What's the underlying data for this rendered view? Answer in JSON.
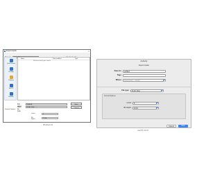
{
  "windows": {
    "title": "Export Audio",
    "close_glyph": "×",
    "save_in_label": "Save in:",
    "save_in_value": "Contents",
    "toolbar_icons": [
      "back-icon",
      "up-folder-icon",
      "new-folder-icon",
      "view-menu-icon"
    ],
    "places": [
      {
        "label": "Quick access",
        "icon": "star-icon"
      },
      {
        "label": "Desktop",
        "icon": "desktop-icon"
      },
      {
        "label": "Libraries",
        "icon": "library-icon"
      },
      {
        "label": "This PC",
        "icon": "computer-icon"
      },
      {
        "label": "Network",
        "icon": "network-icon"
      }
    ],
    "columns": [
      "Name",
      "Date modified",
      "Type"
    ],
    "empty_message": "No items match your search.",
    "file_name_label": "File name:",
    "file_name_value": "untitled",
    "save_type_label": "Save as type:",
    "save_type_value": "FLAC Files",
    "save_button": "Save",
    "cancel_button": "Cancel",
    "format_options_label": "Format Options",
    "level_label": "Level:",
    "level_value": "5",
    "bitdepth_label": "Bit depth:",
    "bitdepth_value": "16 bit",
    "caption": "Windows 10"
  },
  "mac": {
    "title": "Audacity",
    "subtitle": "Export Audio",
    "save_as_label": "Save As:",
    "save_as_value": "untitled",
    "tags_label": "Tags:",
    "tags_value": "",
    "where_label": "Where:",
    "where_value": "Documents — iCloud",
    "file_type_label": "File type:",
    "file_type_value": "FLAC Files",
    "format_options_label": "Format Options",
    "level_label": "Level:",
    "level_value": "5",
    "bitdepth_label": "Bit depth:",
    "bitdepth_value": "16 bit",
    "cancel_button": "Cancel",
    "save_button": "Save",
    "caption": "macOS 10.15"
  }
}
